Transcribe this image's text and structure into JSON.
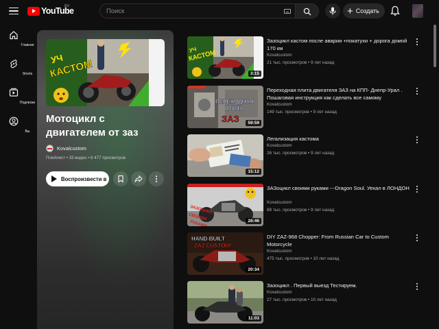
{
  "header": {
    "logo_text": "YouTube",
    "region": "RU",
    "search_placeholder": "Поиск",
    "create_label": "Создать",
    "icons": [
      "menu-icon",
      "keyboard-icon",
      "search-icon",
      "mic-icon",
      "plus-icon",
      "bell-icon"
    ]
  },
  "sidebar": {
    "items": [
      {
        "label": "Главная",
        "icon": "home-icon"
      },
      {
        "label": "Shorts",
        "icon": "shorts-icon"
      },
      {
        "label": "Подписки",
        "icon": "subscriptions-icon"
      },
      {
        "label": "Вы",
        "icon": "you-icon"
      }
    ]
  },
  "playlist": {
    "title": "Мотоцикл с двигателем от заз",
    "thumb_caption": "УЧ КАСТОМ",
    "channel": "Kovalcustom",
    "meta": "Плейлист • 33 видео • 6 477 просмотров",
    "play_all_label": "Воспроизвести все",
    "icons": [
      "save-icon",
      "share-icon",
      "more-icon"
    ]
  },
  "videos": [
    {
      "title": "Зазоцикл кастом после аварии +покатухи + дорога домой 170 км",
      "channel": "Kovalcustom",
      "meta": "21 тыс. просмотров • 9 лет назад",
      "duration": "3:15",
      "thumb_text": "УЧ КАСТОМ"
    },
    {
      "title": "Переходная плита двигателя ЗАЗ на КПП- Днепр-Урал . Пошаговая инструкция как сделать все самому",
      "channel": "Kovalcustom",
      "meta": "149 тыс. просмотров • 9 лет назад",
      "duration": "59:59",
      "thumb_text": "ПЕРЕХОДНАЯ ПЛИТА ЗАЗ"
    },
    {
      "title": "Легализация кастома",
      "channel": "Kovalcustom",
      "meta": "26 тыс. просмотров • 9 лет назад",
      "duration": "15:12",
      "thumb_text": ""
    },
    {
      "title": "ЗАЗоцикл своими руками ---Dragon Soul. Уехал в ЛОНДОН",
      "channel": "Kovalcustom",
      "meta": "88 тыс. просмотров • 9 лет назад",
      "duration": "26:46",
      "thumb_text": "ЗАЗОЦИКЛ СВОИМИ РУКАМИ"
    },
    {
      "title": "DIY ZAZ-968 Chopper: From Russian Car to Custom Motorcycle",
      "channel": "Kovalcustom",
      "meta": "475 тыс. просмотров • 10 лет назад",
      "duration": "20:34",
      "thumb_text": "HAND-BUILT ZAZ CUSTOM"
    },
    {
      "title": "Зазоцикл . Первый выезд Тестируем.",
      "channel": "Kovalcustom",
      "meta": "27 тыс. просмотров • 10 лет назад",
      "duration": "11:03",
      "thumb_text": ""
    }
  ],
  "colors": {
    "background": "#0f0f0f",
    "brand_red": "#ff0000",
    "secondary_text": "#aaaaaa"
  }
}
